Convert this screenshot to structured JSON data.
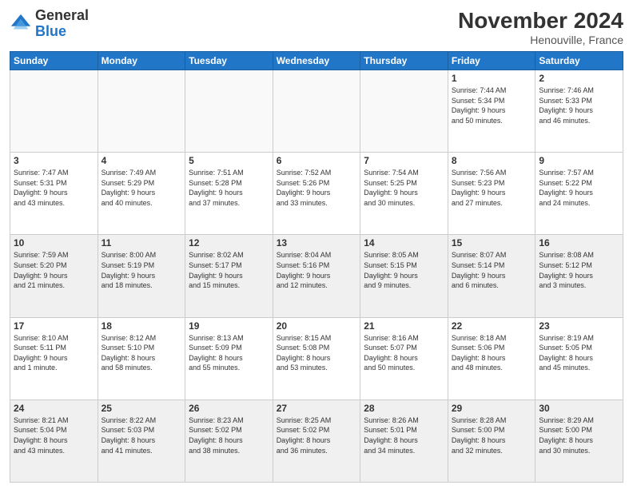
{
  "header": {
    "logo_general": "General",
    "logo_blue": "Blue",
    "month_title": "November 2024",
    "location": "Henouville, France"
  },
  "days_of_week": [
    "Sunday",
    "Monday",
    "Tuesday",
    "Wednesday",
    "Thursday",
    "Friday",
    "Saturday"
  ],
  "weeks": [
    {
      "shaded": false,
      "days": [
        {
          "num": "",
          "info": ""
        },
        {
          "num": "",
          "info": ""
        },
        {
          "num": "",
          "info": ""
        },
        {
          "num": "",
          "info": ""
        },
        {
          "num": "",
          "info": ""
        },
        {
          "num": "1",
          "info": "Sunrise: 7:44 AM\nSunset: 5:34 PM\nDaylight: 9 hours\nand 50 minutes."
        },
        {
          "num": "2",
          "info": "Sunrise: 7:46 AM\nSunset: 5:33 PM\nDaylight: 9 hours\nand 46 minutes."
        }
      ]
    },
    {
      "shaded": false,
      "days": [
        {
          "num": "3",
          "info": "Sunrise: 7:47 AM\nSunset: 5:31 PM\nDaylight: 9 hours\nand 43 minutes."
        },
        {
          "num": "4",
          "info": "Sunrise: 7:49 AM\nSunset: 5:29 PM\nDaylight: 9 hours\nand 40 minutes."
        },
        {
          "num": "5",
          "info": "Sunrise: 7:51 AM\nSunset: 5:28 PM\nDaylight: 9 hours\nand 37 minutes."
        },
        {
          "num": "6",
          "info": "Sunrise: 7:52 AM\nSunset: 5:26 PM\nDaylight: 9 hours\nand 33 minutes."
        },
        {
          "num": "7",
          "info": "Sunrise: 7:54 AM\nSunset: 5:25 PM\nDaylight: 9 hours\nand 30 minutes."
        },
        {
          "num": "8",
          "info": "Sunrise: 7:56 AM\nSunset: 5:23 PM\nDaylight: 9 hours\nand 27 minutes."
        },
        {
          "num": "9",
          "info": "Sunrise: 7:57 AM\nSunset: 5:22 PM\nDaylight: 9 hours\nand 24 minutes."
        }
      ]
    },
    {
      "shaded": true,
      "days": [
        {
          "num": "10",
          "info": "Sunrise: 7:59 AM\nSunset: 5:20 PM\nDaylight: 9 hours\nand 21 minutes."
        },
        {
          "num": "11",
          "info": "Sunrise: 8:00 AM\nSunset: 5:19 PM\nDaylight: 9 hours\nand 18 minutes."
        },
        {
          "num": "12",
          "info": "Sunrise: 8:02 AM\nSunset: 5:17 PM\nDaylight: 9 hours\nand 15 minutes."
        },
        {
          "num": "13",
          "info": "Sunrise: 8:04 AM\nSunset: 5:16 PM\nDaylight: 9 hours\nand 12 minutes."
        },
        {
          "num": "14",
          "info": "Sunrise: 8:05 AM\nSunset: 5:15 PM\nDaylight: 9 hours\nand 9 minutes."
        },
        {
          "num": "15",
          "info": "Sunrise: 8:07 AM\nSunset: 5:14 PM\nDaylight: 9 hours\nand 6 minutes."
        },
        {
          "num": "16",
          "info": "Sunrise: 8:08 AM\nSunset: 5:12 PM\nDaylight: 9 hours\nand 3 minutes."
        }
      ]
    },
    {
      "shaded": false,
      "days": [
        {
          "num": "17",
          "info": "Sunrise: 8:10 AM\nSunset: 5:11 PM\nDaylight: 9 hours\nand 1 minute."
        },
        {
          "num": "18",
          "info": "Sunrise: 8:12 AM\nSunset: 5:10 PM\nDaylight: 8 hours\nand 58 minutes."
        },
        {
          "num": "19",
          "info": "Sunrise: 8:13 AM\nSunset: 5:09 PM\nDaylight: 8 hours\nand 55 minutes."
        },
        {
          "num": "20",
          "info": "Sunrise: 8:15 AM\nSunset: 5:08 PM\nDaylight: 8 hours\nand 53 minutes."
        },
        {
          "num": "21",
          "info": "Sunrise: 8:16 AM\nSunset: 5:07 PM\nDaylight: 8 hours\nand 50 minutes."
        },
        {
          "num": "22",
          "info": "Sunrise: 8:18 AM\nSunset: 5:06 PM\nDaylight: 8 hours\nand 48 minutes."
        },
        {
          "num": "23",
          "info": "Sunrise: 8:19 AM\nSunset: 5:05 PM\nDaylight: 8 hours\nand 45 minutes."
        }
      ]
    },
    {
      "shaded": true,
      "days": [
        {
          "num": "24",
          "info": "Sunrise: 8:21 AM\nSunset: 5:04 PM\nDaylight: 8 hours\nand 43 minutes."
        },
        {
          "num": "25",
          "info": "Sunrise: 8:22 AM\nSunset: 5:03 PM\nDaylight: 8 hours\nand 41 minutes."
        },
        {
          "num": "26",
          "info": "Sunrise: 8:23 AM\nSunset: 5:02 PM\nDaylight: 8 hours\nand 38 minutes."
        },
        {
          "num": "27",
          "info": "Sunrise: 8:25 AM\nSunset: 5:02 PM\nDaylight: 8 hours\nand 36 minutes."
        },
        {
          "num": "28",
          "info": "Sunrise: 8:26 AM\nSunset: 5:01 PM\nDaylight: 8 hours\nand 34 minutes."
        },
        {
          "num": "29",
          "info": "Sunrise: 8:28 AM\nSunset: 5:00 PM\nDaylight: 8 hours\nand 32 minutes."
        },
        {
          "num": "30",
          "info": "Sunrise: 8:29 AM\nSunset: 5:00 PM\nDaylight: 8 hours\nand 30 minutes."
        }
      ]
    }
  ]
}
